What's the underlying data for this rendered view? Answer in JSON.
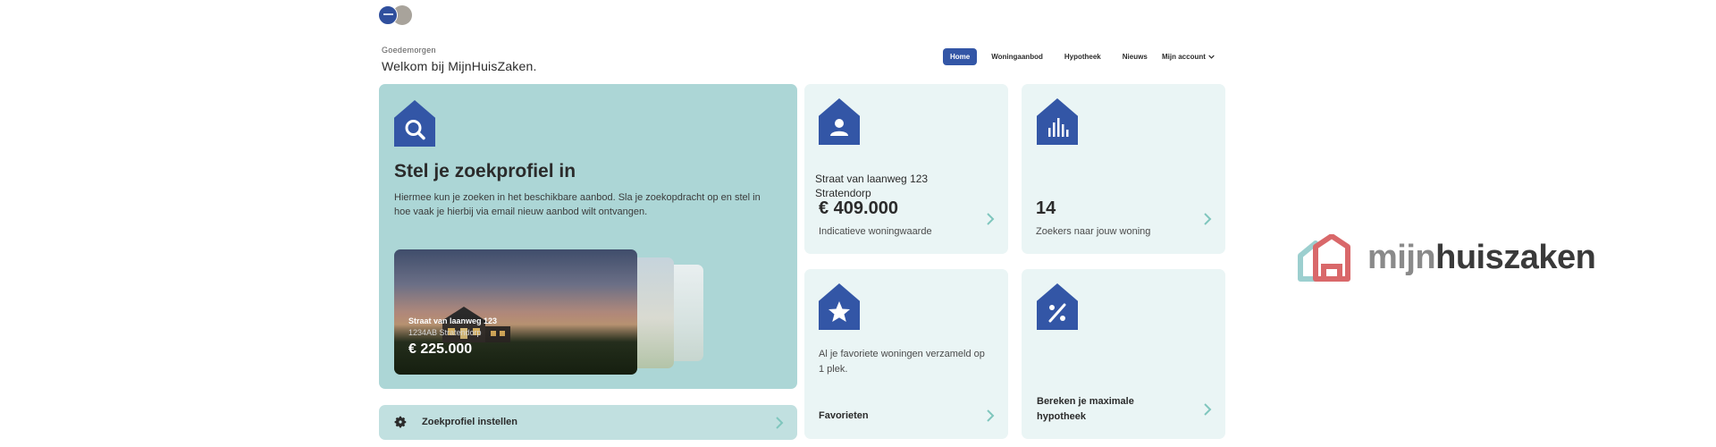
{
  "header": {
    "greeting": "Goedemorgen",
    "welcome": "Welkom bij MijnHuisZaken.",
    "nav": [
      {
        "label": "Home",
        "active": true
      },
      {
        "label": "Woningaanbod",
        "active": false
      },
      {
        "label": "Hypotheek",
        "active": false
      },
      {
        "label": "Nieuws",
        "active": false
      }
    ],
    "account_label": "Mijn account"
  },
  "hero": {
    "icon": "search-icon",
    "title": "Stel je zoekprofiel in",
    "description": "Hiermee kun je zoeken in het beschikbare aanbod. Sla je zoekopdracht op en stel in hoe vaak je hierbij via email nieuw aanbod wilt ontvangen.",
    "listing": {
      "street": "Straat van laanweg 123",
      "city": "1234AB Stratendorp",
      "price": "€ 225.000"
    }
  },
  "search_bar": {
    "icon": "gear-icon",
    "label": "Zoekprofiel instellen"
  },
  "tiles": {
    "value": {
      "icon": "user-icon",
      "address_line1": "Straat van laanweg 123",
      "address_line2": "Stratendorp",
      "amount": "€ 409.000",
      "label": "Indicatieve woningwaarde"
    },
    "seekers": {
      "icon": "bar-chart-icon",
      "count": "14",
      "label": "Zoekers naar jouw woning"
    },
    "favorites": {
      "icon": "star-icon",
      "description": "Al je favoriete woningen verzameld op 1 plek.",
      "title": "Favorieten"
    },
    "mortgage": {
      "icon": "percent-icon",
      "title": "Bereken je maximale hypotheek"
    }
  },
  "brand": {
    "word_light": "mijn",
    "word_dark": "huiszaken"
  },
  "colors": {
    "accent": "#3356a6",
    "hero_bg": "#acd6d6",
    "tile_bg": "#eaf5f5",
    "chevron": "#7fc6bd"
  }
}
